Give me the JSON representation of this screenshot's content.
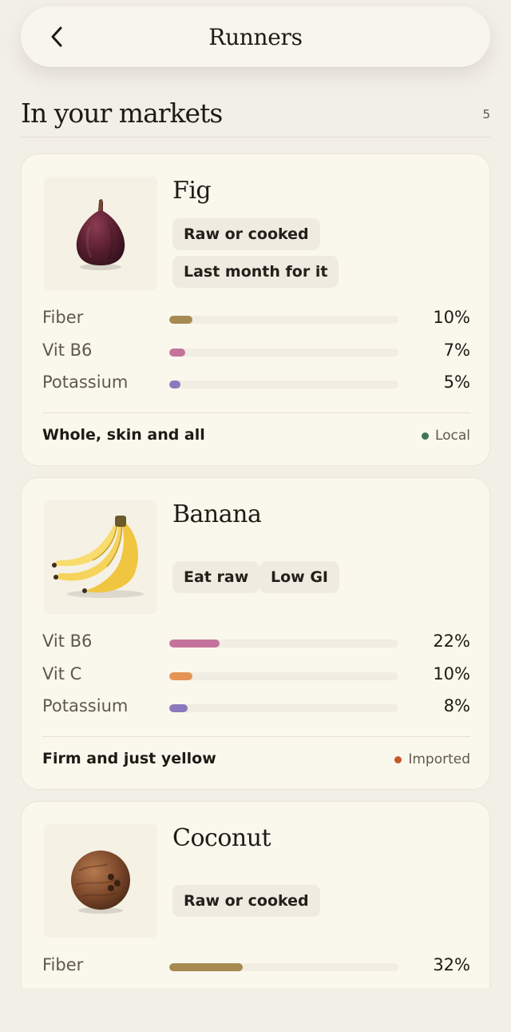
{
  "header": {
    "title": "Runners",
    "back_icon": "chevron-left-icon"
  },
  "section": {
    "title": "In your markets",
    "count": "5"
  },
  "colors": {
    "fiber": "#a58a52",
    "vit_b6": "#c4739c",
    "vit_c": "#e49555",
    "potassium": "#8c79bd",
    "local": "#3f7457",
    "imported": "#c45a25"
  },
  "foods": [
    {
      "name": "Fig",
      "image_icon": "fig-image",
      "tags": [
        "Raw or cooked",
        "Last month for it"
      ],
      "nutrients": [
        {
          "label": "Fiber",
          "value": "10%",
          "fraction": 0.1,
          "color_key": "fiber"
        },
        {
          "label": "Vit B6",
          "value": "7%",
          "fraction": 0.07,
          "color_key": "vit_b6"
        },
        {
          "label": "Potassium",
          "value": "5%",
          "fraction": 0.05,
          "color_key": "potassium"
        }
      ],
      "note": "Whole, skin and all",
      "origin": "Local"
    },
    {
      "name": "Banana",
      "image_icon": "banana-image",
      "tags": [
        "Eat raw",
        "Low GI"
      ],
      "nutrients": [
        {
          "label": "Vit B6",
          "value": "22%",
          "fraction": 0.22,
          "color_key": "vit_b6"
        },
        {
          "label": "Vit C",
          "value": "10%",
          "fraction": 0.1,
          "color_key": "vit_c"
        },
        {
          "label": "Potassium",
          "value": "8%",
          "fraction": 0.08,
          "color_key": "potassium"
        }
      ],
      "note": "Firm and just yellow",
      "origin": "Imported"
    },
    {
      "name": "Coconut",
      "image_icon": "coconut-image",
      "tags": [
        "Raw or cooked"
      ],
      "nutrients": [
        {
          "label": "Fiber",
          "value": "32%",
          "fraction": 0.32,
          "color_key": "fiber"
        }
      ],
      "note": "",
      "origin": ""
    }
  ]
}
